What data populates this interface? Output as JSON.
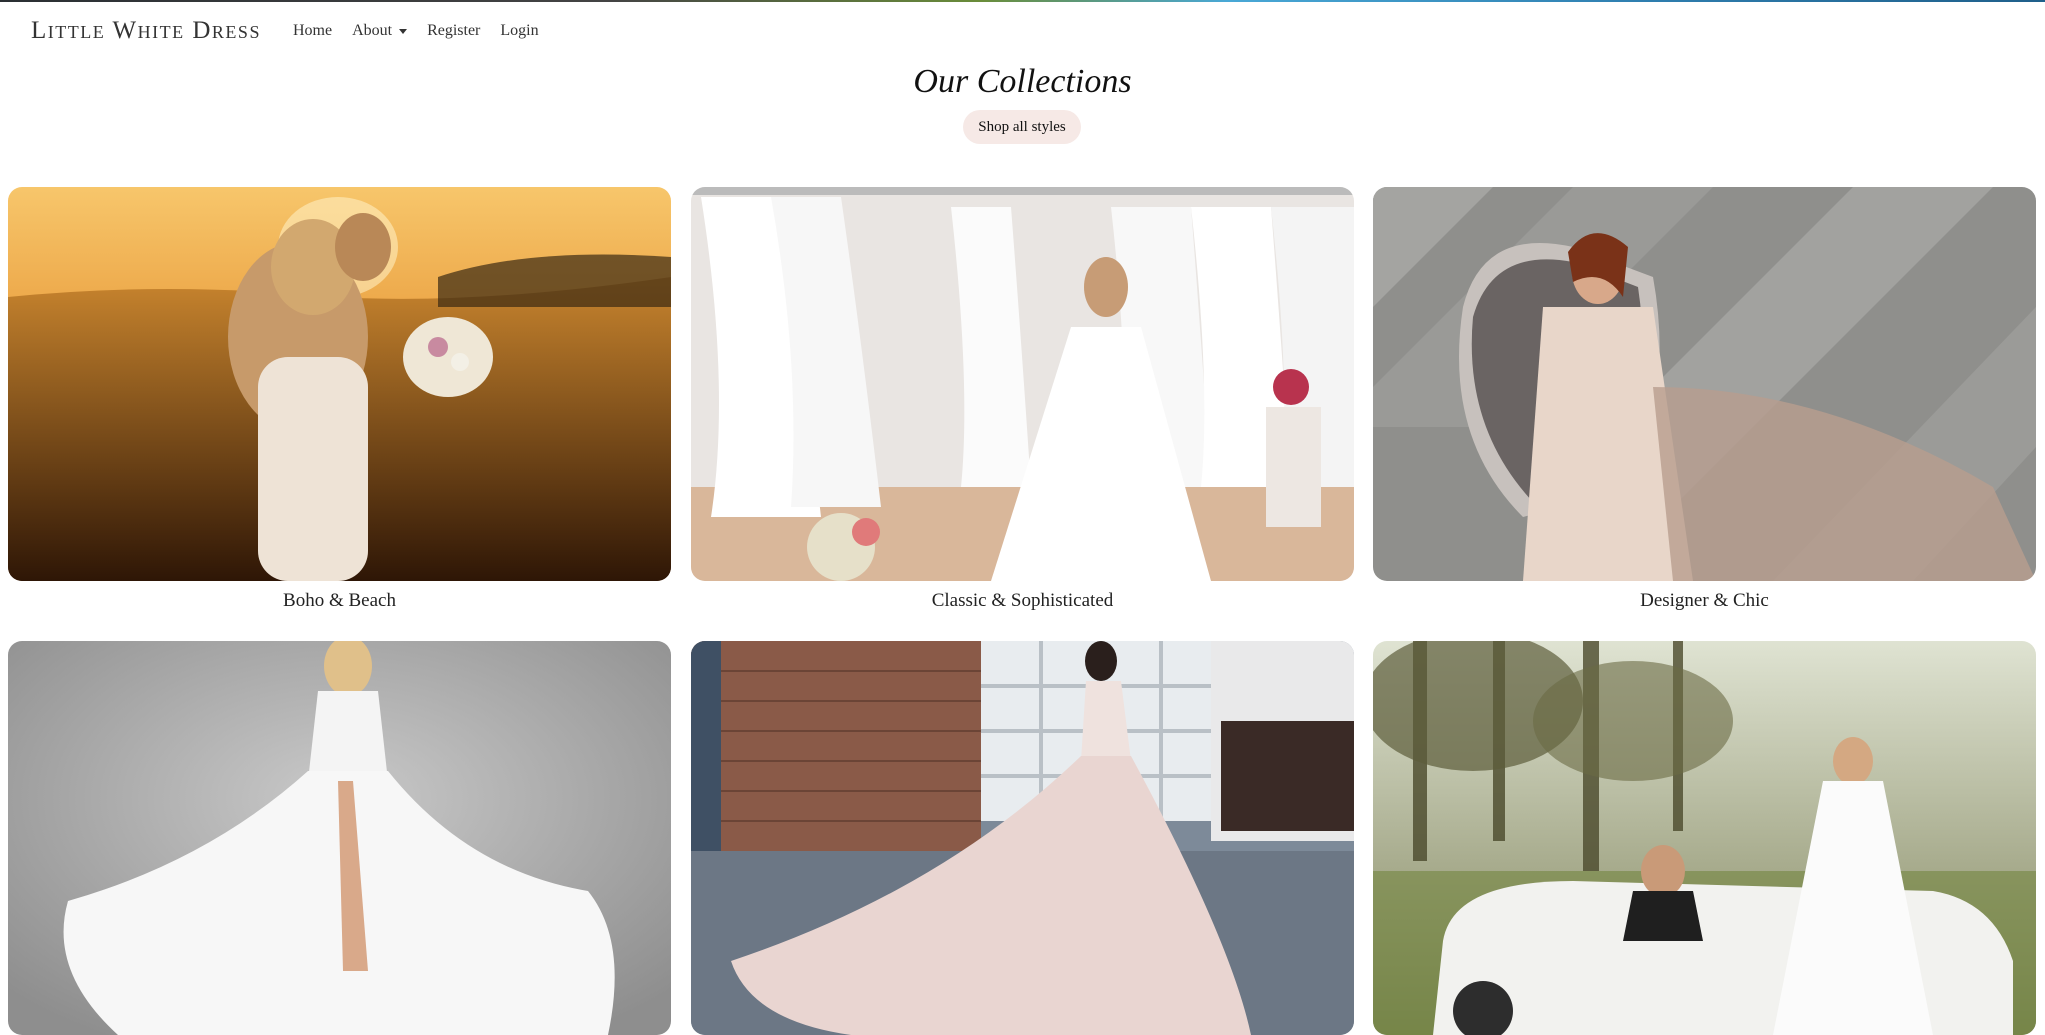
{
  "navbar": {
    "brand": "Little White Dress",
    "links": [
      {
        "label": "Home"
      },
      {
        "label": "About",
        "dropdown": true
      },
      {
        "label": "Register"
      },
      {
        "label": "Login"
      }
    ]
  },
  "main": {
    "heading": "Our Collections",
    "shop_button": "Shop all styles",
    "collections": [
      {
        "label": "Boho & Beach"
      },
      {
        "label": "Classic & Sophisticated"
      },
      {
        "label": "Designer & Chic"
      },
      {
        "label": ""
      },
      {
        "label": ""
      },
      {
        "label": ""
      }
    ]
  },
  "colors": {
    "shop_button_bg": "#f6e9e6",
    "text": "#222222"
  }
}
